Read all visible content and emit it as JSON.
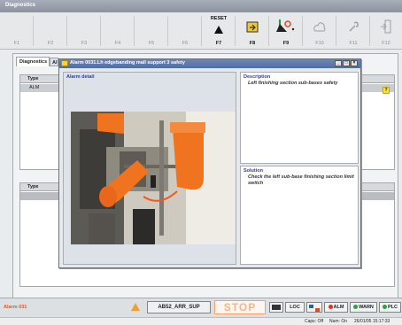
{
  "window": {
    "title": "Diagnostics"
  },
  "toolbar": {
    "keys": [
      {
        "label": "F1",
        "caption": ""
      },
      {
        "label": "F2",
        "caption": ""
      },
      {
        "label": "F3",
        "caption": ""
      },
      {
        "label": "F4",
        "caption": ""
      },
      {
        "label": "F5",
        "caption": ""
      },
      {
        "label": "F6",
        "caption": ""
      },
      {
        "label": "F7",
        "caption": "RESET"
      },
      {
        "label": "F8",
        "caption": ""
      },
      {
        "label": "F9",
        "caption": ""
      },
      {
        "label": "F10",
        "caption": ""
      },
      {
        "label": "F11",
        "caption": ""
      },
      {
        "label": "F12",
        "caption": ""
      }
    ]
  },
  "tabs": {
    "diagnostics": "Diagnostics",
    "second": "Al"
  },
  "upper_table": {
    "col_type": "Type",
    "row_type": "ALM"
  },
  "lower_table": {
    "col_type": "Type"
  },
  "popup": {
    "title": "Alarm 0031.Lh edgebanding mall support 3 safety",
    "alarm_detail_heading": "Alarm detail",
    "description_heading": "Description",
    "description_text": "Left finishing section sub-bases safety",
    "solution_heading": "Solution",
    "solution_text": "Check the left sub-base finishing section limit switch"
  },
  "status": {
    "alarm_label": "Alarm 031",
    "code": "AB52_ARR_SUP",
    "stop": "STOP",
    "loc": "LOC",
    "alm": "ALM",
    "warn": "WARN",
    "plc": "PLC",
    "caps": "Caps: Off",
    "num": "Num: On",
    "datetime": "26/01/05 15:17:33"
  },
  "colors": {
    "accent_orange": "#e8551e",
    "title_blue": "#4f6ca8",
    "heading_blue": "#2b3da8"
  }
}
